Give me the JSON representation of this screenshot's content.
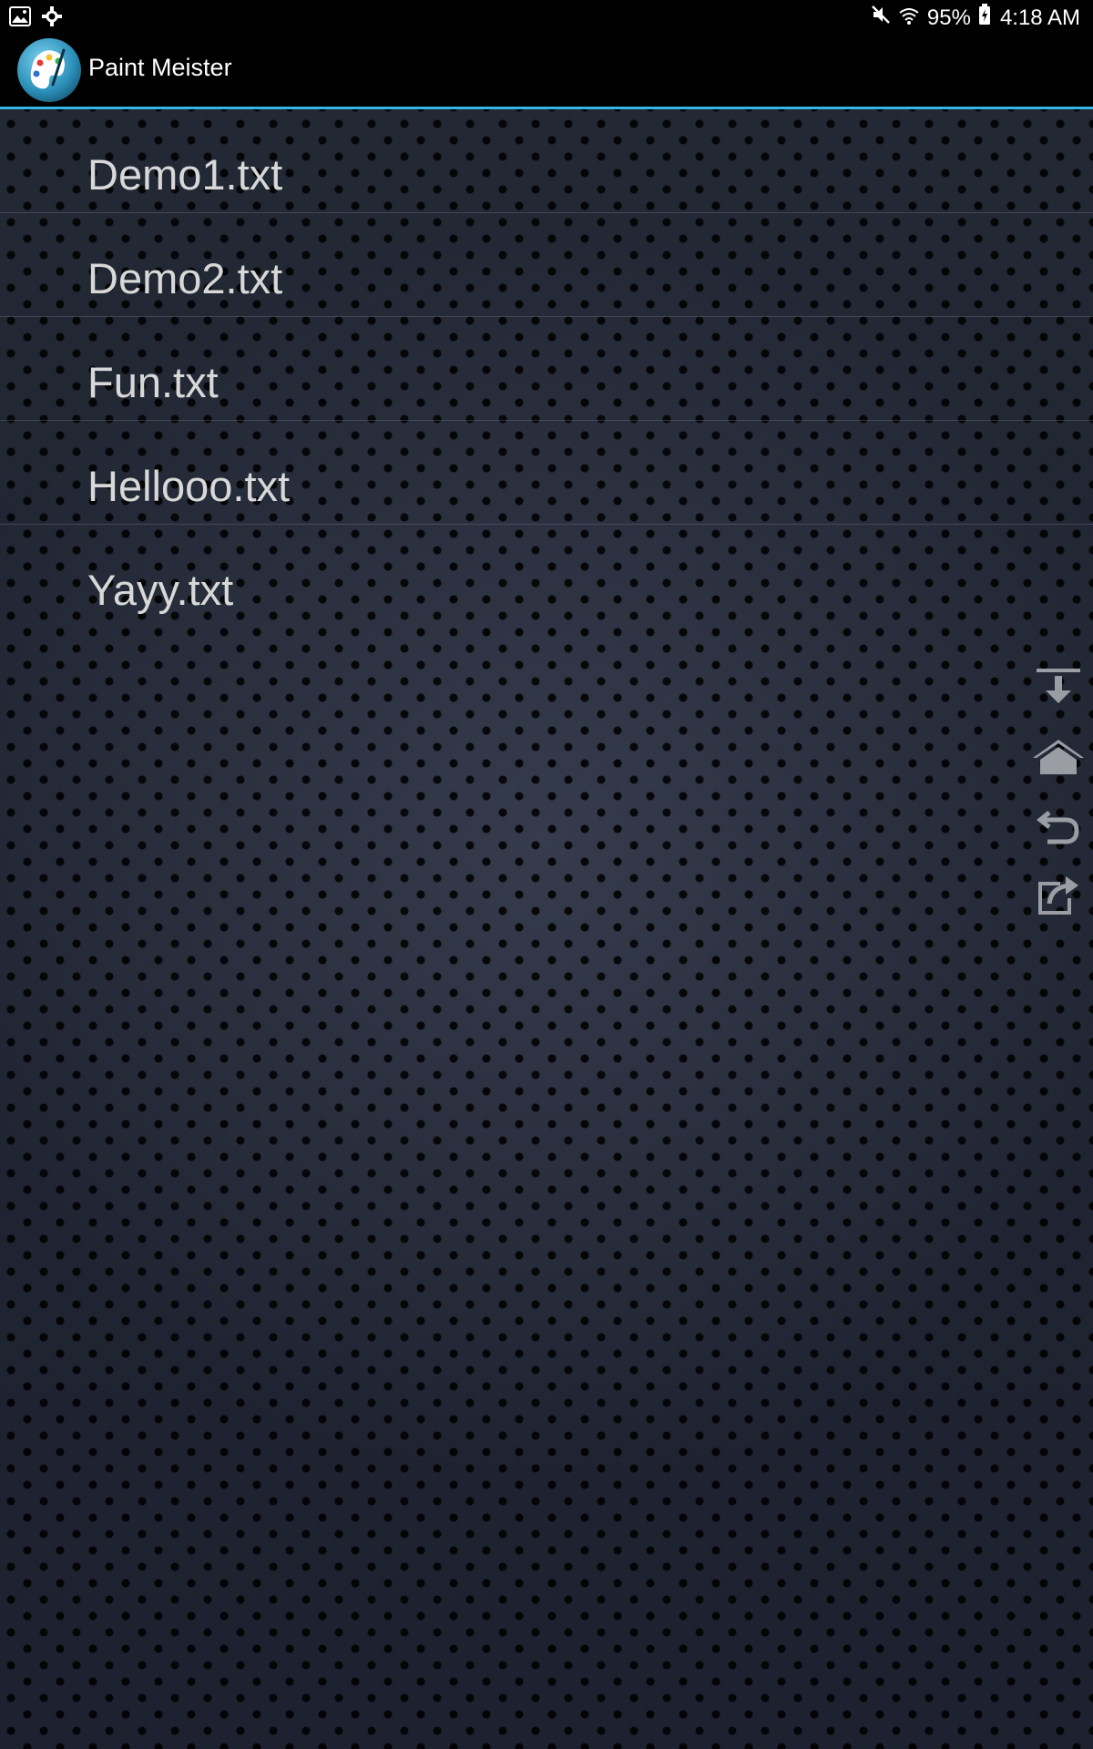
{
  "status_bar": {
    "battery_percent": "95%",
    "time": "4:18 AM",
    "icons": [
      "gallery-icon",
      "settings-tool-icon",
      "mute-icon",
      "wifi-icon",
      "battery-charging-icon"
    ]
  },
  "app_bar": {
    "title": "Paint Meister",
    "logo_icon": "palette-logo-icon",
    "accent_color": "#33b5e5"
  },
  "files": [
    {
      "name": "Demo1.txt"
    },
    {
      "name": "Demo2.txt"
    },
    {
      "name": "Fun.txt"
    },
    {
      "name": "Hellooo.txt"
    },
    {
      "name": "Yayy.txt"
    }
  ],
  "side_tools": [
    {
      "icon": "download-icon"
    },
    {
      "icon": "home-icon"
    },
    {
      "icon": "back-icon"
    },
    {
      "icon": "share-icon"
    }
  ]
}
